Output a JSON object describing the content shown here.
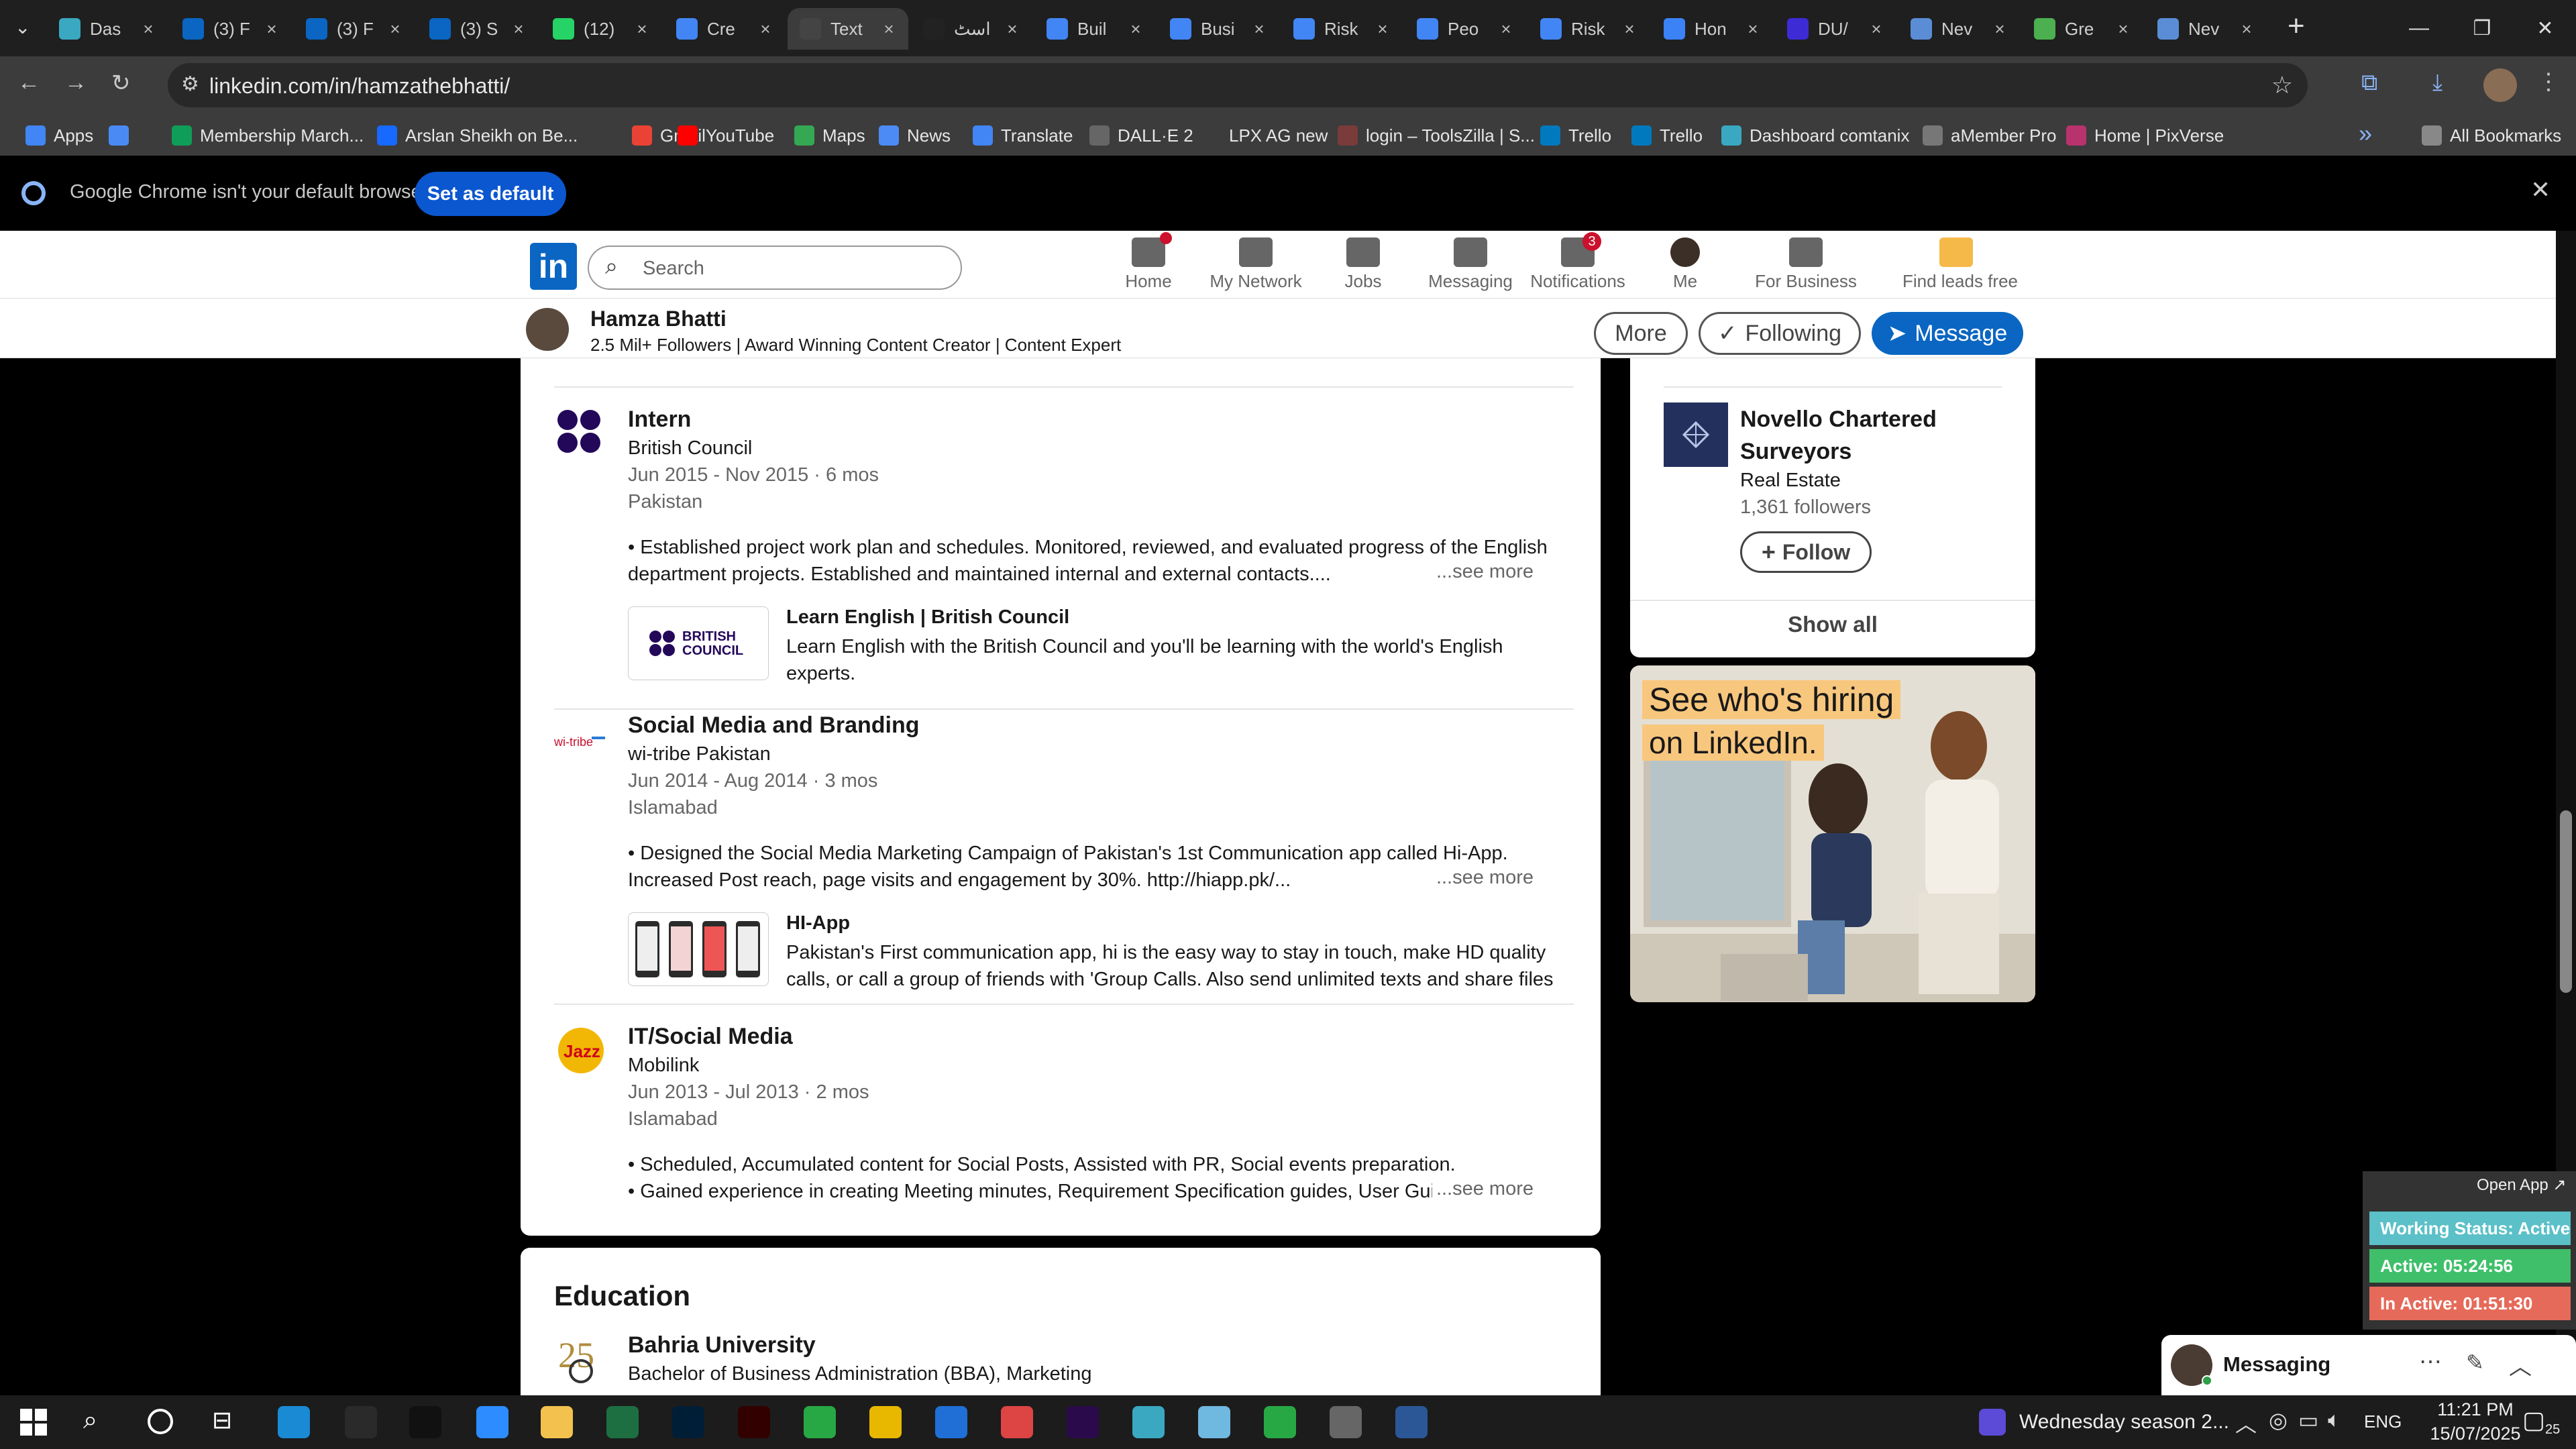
{
  "tabs": [
    {
      "title": "Das",
      "icon": "teal-diamond-icon",
      "color": "#3aa8c1"
    },
    {
      "title": "(3) F",
      "icon": "linkedin-icon",
      "color": "#0a66c2"
    },
    {
      "title": "(3) F",
      "icon": "linkedin-icon",
      "color": "#0a66c2"
    },
    {
      "title": "(3) S",
      "icon": "linkedin-icon",
      "color": "#0a66c2"
    },
    {
      "title": "(12)",
      "icon": "whatsapp-icon",
      "color": "#25d366"
    },
    {
      "title": "Cre",
      "icon": "docs-icon",
      "color": "#4285f4"
    },
    {
      "title": "Text",
      "icon": "pause-icon",
      "color": "#444444"
    },
    {
      "title": "اسٹ",
      "icon": "chatgpt-icon",
      "color": "#222222"
    },
    {
      "title": "Buil",
      "icon": "docs-icon",
      "color": "#4285f4"
    },
    {
      "title": "Busi",
      "icon": "docs-icon",
      "color": "#4285f4"
    },
    {
      "title": "Risk",
      "icon": "docs-icon",
      "color": "#4285f4"
    },
    {
      "title": "Peo",
      "icon": "docs-icon",
      "color": "#4285f4"
    },
    {
      "title": "Risk",
      "icon": "docs-icon",
      "color": "#4285f4"
    },
    {
      "title": "Hon",
      "icon": "circle-c-icon",
      "color": "#3b82f6"
    },
    {
      "title": "DU/",
      "icon": "video-icon",
      "color": "#3d2bd6"
    },
    {
      "title": "Nev",
      "icon": "globe-icon",
      "color": "#5a8dd6"
    },
    {
      "title": "Gre",
      "icon": "leaf-icon",
      "color": "#4caf50"
    },
    {
      "title": "Nev",
      "icon": "globe-icon",
      "color": "#5a8dd6"
    }
  ],
  "active_tab_index": 6,
  "address": {
    "url": "linkedin.com/in/hamzathebhatti/"
  },
  "bookmarks": [
    {
      "label": "Apps",
      "color": "#4285f4"
    },
    {
      "label": "",
      "color": "#4a8af4"
    },
    {
      "label": "Membership March...",
      "color": "#0f9d58"
    },
    {
      "label": "Arslan Sheikh on Be...",
      "color": "#1769ff"
    },
    {
      "label": "Gmail",
      "color": "#ea4335"
    },
    {
      "label": "YouTube",
      "color": "#ff0000"
    },
    {
      "label": "Maps",
      "color": "#34a853"
    },
    {
      "label": "News",
      "color": "#4c8bf5"
    },
    {
      "label": "Translate",
      "color": "#4285f4"
    },
    {
      "label": "DALL·E 2",
      "color": "#666666"
    },
    {
      "label": "LPX AG new",
      "color": "#3c3c3c"
    },
    {
      "label": "login – ToolsZilla | S...",
      "color": "#7a3b3b"
    },
    {
      "label": "Trello",
      "color": "#0079bf"
    },
    {
      "label": "Trello",
      "color": "#0079bf"
    },
    {
      "label": "Dashboard comtanix",
      "color": "#3aa8c1"
    },
    {
      "label": "aMember Pro",
      "color": "#777777"
    },
    {
      "label": "Home | PixVerse",
      "color": "#b8326e"
    },
    {
      "label": "All Bookmarks",
      "color": "#888888"
    }
  ],
  "infobar": {
    "message": "Google Chrome isn't your default browser",
    "button": "Set as default"
  },
  "linkedin_nav": {
    "search_placeholder": "Search",
    "items": [
      {
        "label": "Home",
        "badge": ""
      },
      {
        "label": "My Network",
        "badge": ""
      },
      {
        "label": "Jobs",
        "badge": ""
      },
      {
        "label": "Messaging",
        "badge": ""
      },
      {
        "label": "Notifications",
        "badge": "3"
      },
      {
        "label": "Me",
        "badge": ""
      },
      {
        "label": "For Business",
        "badge": ""
      },
      {
        "label": "Find leads free",
        "badge": ""
      }
    ]
  },
  "profile": {
    "name": "Hamza Bhatti",
    "headline": "2.5 Mil+ Followers | Award Winning Content Creator | Content Expert",
    "more": "More",
    "following": "Following",
    "message": "Message"
  },
  "experience": [
    {
      "role": "Intern",
      "org": "British Council",
      "dates": "Jun 2015 - Nov 2015 · 6 mos",
      "location": "Pakistan",
      "desc": "• Established project work plan and schedules. Monitored, reviewed, and evaluated progress of the English department projects. Established and maintained internal and external contacts....",
      "media_title": "Learn English | British Council",
      "media_desc": "Learn English with the British Council and you'll be learning with the world's English experts.",
      "media_logo": "BRITISH COUNCIL"
    },
    {
      "role": "Social Media and Branding",
      "org": "wi-tribe Pakistan",
      "dates": "Jun 2014 - Aug 2014 · 3 mos",
      "location": "Islamabad",
      "desc": "• Designed the Social Media Marketing Campaign of Pakistan's 1st Communication app called Hi-App. Increased Post reach, page visits and engagement by 30%. http://hiapp.pk/...",
      "media_title": "HI-App",
      "media_desc": "Pakistan's First communication app, hi is the easy way to stay in touch, make HD quality calls, or call a group of friends with 'Group Calls. Also send unlimited texts and share files with you..."
    },
    {
      "role": "IT/Social Media",
      "org": "Mobilink",
      "dates": "Jun 2013 - Jul 2013 · 2 mos",
      "location": "Islamabad",
      "desc1": "• Scheduled, Accumulated content for Social Posts, Assisted with PR, Social events preparation.",
      "desc2": "• Gained experience in creating Meeting minutes, Requirement Specification guides, User Guides & Sys"
    }
  ],
  "see_more": "...see more",
  "education": {
    "heading": "Education",
    "school": "Bahria University",
    "degree": "Bachelor of Business Administration (BBA), Marketing"
  },
  "sidebar": {
    "company": "Novello Chartered Surveyors",
    "company_l1": "Novello Chartered",
    "company_l2": "Surveyors",
    "industry": "Real Estate",
    "followers": "1,361 followers",
    "follow": "Follow",
    "show_all": "Show all",
    "ad_line1": "See who's hiring",
    "ad_line2": "on LinkedIn."
  },
  "tracker": {
    "open_app": "Open App ↗",
    "status": "Working Status: Active",
    "active": "Active: 05:24:56",
    "inactive": "In Active: 01:51:30"
  },
  "messaging": {
    "label": "Messaging"
  },
  "taskbar": {
    "media": "Wednesday season 2...",
    "lang": "ENG",
    "time": "11:21 PM",
    "date": "15/07/2025",
    "notif_count": "25"
  }
}
